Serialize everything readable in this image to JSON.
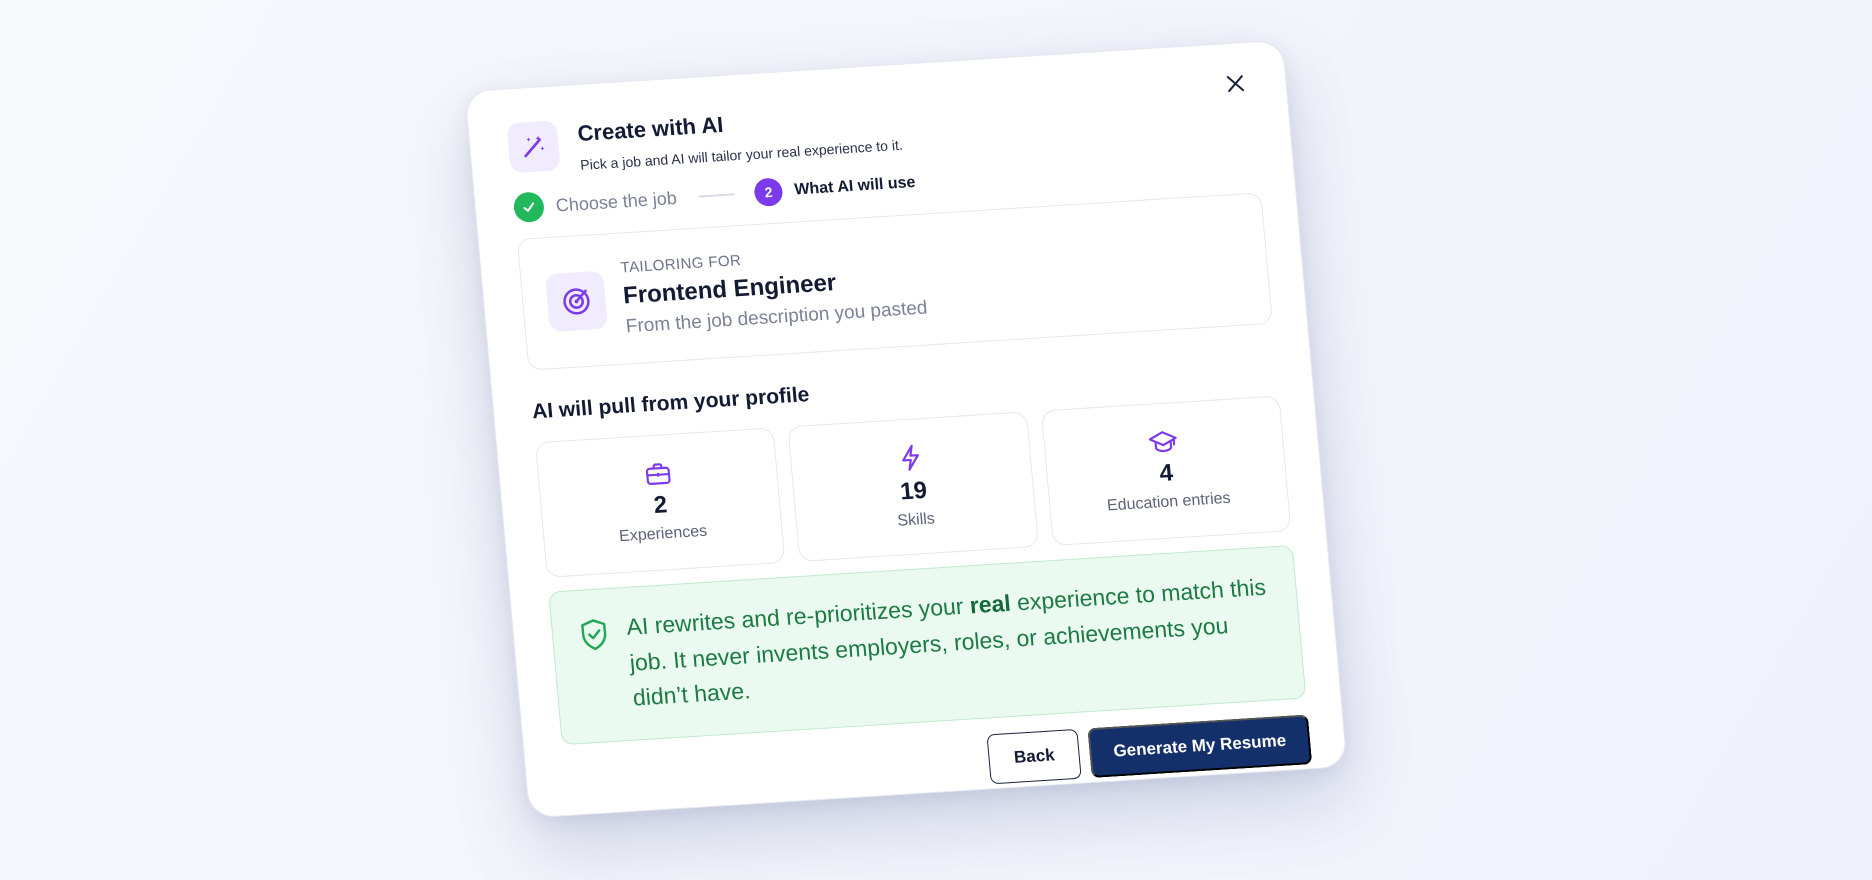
{
  "modal": {
    "title": "Create with AI",
    "subtitle": "Pick a job and AI will tailor your real experience to it.",
    "close_icon": "close-icon"
  },
  "stepper": {
    "step1_label": "Choose the job",
    "step2_number": "2",
    "step2_label": "What AI will use"
  },
  "job": {
    "eyebrow": "TAILORING FOR",
    "title": "Frontend Engineer",
    "source": "From the job description you pasted"
  },
  "profile": {
    "section_title": "AI will pull from your profile",
    "stats": [
      {
        "icon": "briefcase-icon",
        "count": "2",
        "label": "Experiences"
      },
      {
        "icon": "lightning-icon",
        "count": "19",
        "label": "Skills"
      },
      {
        "icon": "graduation-cap-icon",
        "count": "4",
        "label": "Education entries"
      }
    ]
  },
  "notice": {
    "pre": "AI rewrites and re-prioritizes your ",
    "emphasis": "real",
    "post": " experience to match this job. It never invents employers, roles, or achievements you didn’t have."
  },
  "actions": {
    "back_label": "Back",
    "generate_label": "Generate My Resume"
  },
  "colors": {
    "accent": "#7c3aed",
    "success": "#22b85c",
    "primary_button": "#14306a",
    "notice_bg": "#eafaf0"
  }
}
